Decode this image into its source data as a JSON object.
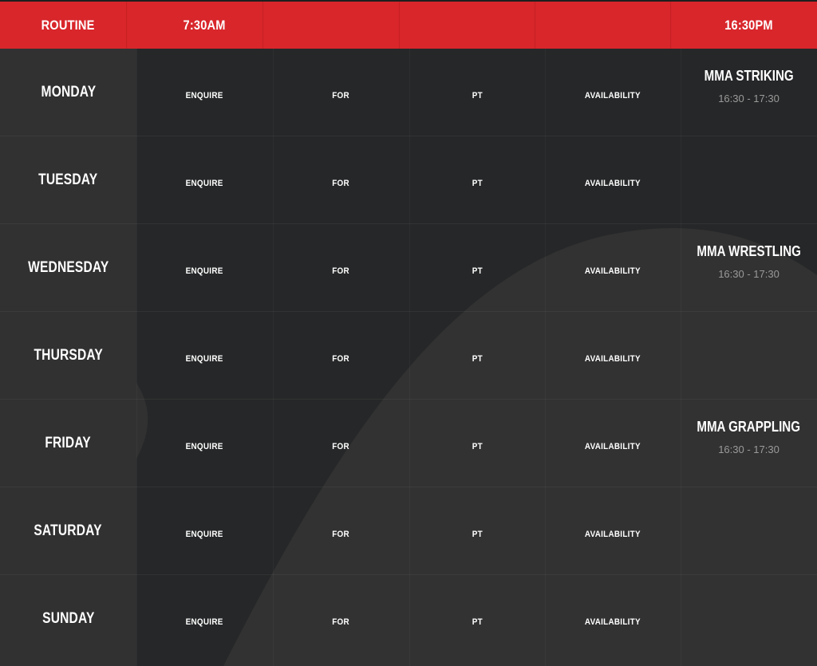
{
  "header": {
    "routine_label": "ROUTINE",
    "col_1": "7:30AM",
    "col_2": "",
    "col_3": "",
    "col_4": "",
    "col_5": "16:30PM"
  },
  "colors": {
    "header_bg": "#d8262b",
    "page_bg": "#262728",
    "day_col_bg": "#313132",
    "curve_bg": "#323232",
    "time_text": "#9a9a9a"
  },
  "days": [
    {
      "name": "MONDAY",
      "slots": [
        "ENQUIRE",
        "FOR",
        "PT",
        "AVAILABILITY"
      ],
      "class": {
        "name": "MMA STRIKING",
        "time": "16:30 - 17:30"
      }
    },
    {
      "name": "TUESDAY",
      "slots": [
        "ENQUIRE",
        "FOR",
        "PT",
        "AVAILABILITY"
      ],
      "class": {
        "name": "",
        "time": ""
      }
    },
    {
      "name": "WEDNESDAY",
      "slots": [
        "ENQUIRE",
        "FOR",
        "PT",
        "AVAILABILITY"
      ],
      "class": {
        "name": "MMA WRESTLING",
        "time": "16:30 - 17:30"
      }
    },
    {
      "name": "THURSDAY",
      "slots": [
        "ENQUIRE",
        "FOR",
        "PT",
        "AVAILABILITY"
      ],
      "class": {
        "name": "",
        "time": ""
      }
    },
    {
      "name": "FRIDAY",
      "slots": [
        "ENQUIRE",
        "FOR",
        "PT",
        "AVAILABILITY"
      ],
      "class": {
        "name": "MMA GRAPPLING",
        "time": "16:30 - 17:30"
      }
    },
    {
      "name": "SATURDAY",
      "slots": [
        "ENQUIRE",
        "FOR",
        "PT",
        "AVAILABILITY"
      ],
      "class": {
        "name": "",
        "time": ""
      }
    },
    {
      "name": "SUNDAY",
      "slots": [
        "ENQUIRE",
        "FOR",
        "PT",
        "AVAILABILITY"
      ],
      "class": {
        "name": "",
        "time": ""
      }
    }
  ]
}
